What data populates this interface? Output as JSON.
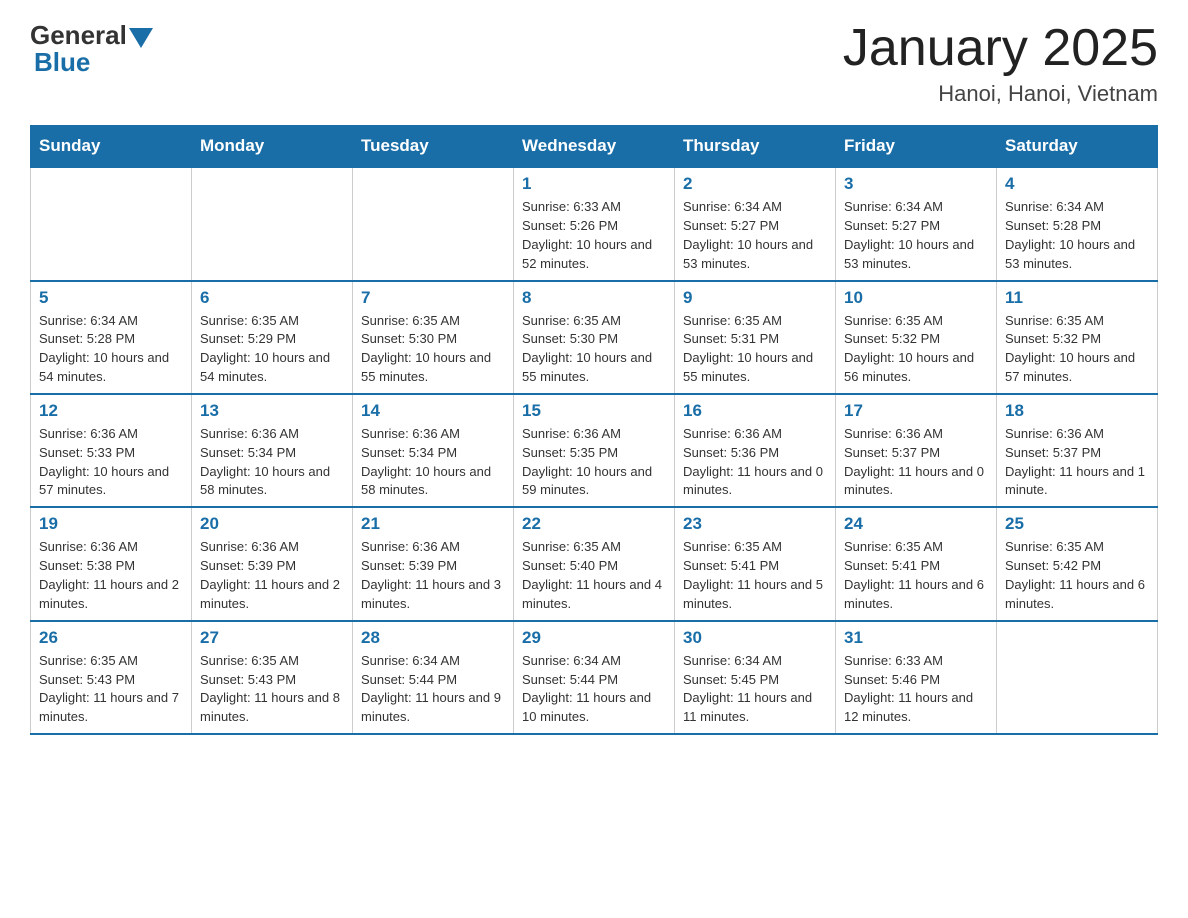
{
  "header": {
    "logo_general": "General",
    "logo_blue": "Blue",
    "month_title": "January 2025",
    "location": "Hanoi, Hanoi, Vietnam"
  },
  "weekdays": [
    "Sunday",
    "Monday",
    "Tuesday",
    "Wednesday",
    "Thursday",
    "Friday",
    "Saturday"
  ],
  "weeks": [
    [
      {
        "day": "",
        "info": ""
      },
      {
        "day": "",
        "info": ""
      },
      {
        "day": "",
        "info": ""
      },
      {
        "day": "1",
        "info": "Sunrise: 6:33 AM\nSunset: 5:26 PM\nDaylight: 10 hours and 52 minutes."
      },
      {
        "day": "2",
        "info": "Sunrise: 6:34 AM\nSunset: 5:27 PM\nDaylight: 10 hours and 53 minutes."
      },
      {
        "day": "3",
        "info": "Sunrise: 6:34 AM\nSunset: 5:27 PM\nDaylight: 10 hours and 53 minutes."
      },
      {
        "day": "4",
        "info": "Sunrise: 6:34 AM\nSunset: 5:28 PM\nDaylight: 10 hours and 53 minutes."
      }
    ],
    [
      {
        "day": "5",
        "info": "Sunrise: 6:34 AM\nSunset: 5:28 PM\nDaylight: 10 hours and 54 minutes."
      },
      {
        "day": "6",
        "info": "Sunrise: 6:35 AM\nSunset: 5:29 PM\nDaylight: 10 hours and 54 minutes."
      },
      {
        "day": "7",
        "info": "Sunrise: 6:35 AM\nSunset: 5:30 PM\nDaylight: 10 hours and 55 minutes."
      },
      {
        "day": "8",
        "info": "Sunrise: 6:35 AM\nSunset: 5:30 PM\nDaylight: 10 hours and 55 minutes."
      },
      {
        "day": "9",
        "info": "Sunrise: 6:35 AM\nSunset: 5:31 PM\nDaylight: 10 hours and 55 minutes."
      },
      {
        "day": "10",
        "info": "Sunrise: 6:35 AM\nSunset: 5:32 PM\nDaylight: 10 hours and 56 minutes."
      },
      {
        "day": "11",
        "info": "Sunrise: 6:35 AM\nSunset: 5:32 PM\nDaylight: 10 hours and 57 minutes."
      }
    ],
    [
      {
        "day": "12",
        "info": "Sunrise: 6:36 AM\nSunset: 5:33 PM\nDaylight: 10 hours and 57 minutes."
      },
      {
        "day": "13",
        "info": "Sunrise: 6:36 AM\nSunset: 5:34 PM\nDaylight: 10 hours and 58 minutes."
      },
      {
        "day": "14",
        "info": "Sunrise: 6:36 AM\nSunset: 5:34 PM\nDaylight: 10 hours and 58 minutes."
      },
      {
        "day": "15",
        "info": "Sunrise: 6:36 AM\nSunset: 5:35 PM\nDaylight: 10 hours and 59 minutes."
      },
      {
        "day": "16",
        "info": "Sunrise: 6:36 AM\nSunset: 5:36 PM\nDaylight: 11 hours and 0 minutes."
      },
      {
        "day": "17",
        "info": "Sunrise: 6:36 AM\nSunset: 5:37 PM\nDaylight: 11 hours and 0 minutes."
      },
      {
        "day": "18",
        "info": "Sunrise: 6:36 AM\nSunset: 5:37 PM\nDaylight: 11 hours and 1 minute."
      }
    ],
    [
      {
        "day": "19",
        "info": "Sunrise: 6:36 AM\nSunset: 5:38 PM\nDaylight: 11 hours and 2 minutes."
      },
      {
        "day": "20",
        "info": "Sunrise: 6:36 AM\nSunset: 5:39 PM\nDaylight: 11 hours and 2 minutes."
      },
      {
        "day": "21",
        "info": "Sunrise: 6:36 AM\nSunset: 5:39 PM\nDaylight: 11 hours and 3 minutes."
      },
      {
        "day": "22",
        "info": "Sunrise: 6:35 AM\nSunset: 5:40 PM\nDaylight: 11 hours and 4 minutes."
      },
      {
        "day": "23",
        "info": "Sunrise: 6:35 AM\nSunset: 5:41 PM\nDaylight: 11 hours and 5 minutes."
      },
      {
        "day": "24",
        "info": "Sunrise: 6:35 AM\nSunset: 5:41 PM\nDaylight: 11 hours and 6 minutes."
      },
      {
        "day": "25",
        "info": "Sunrise: 6:35 AM\nSunset: 5:42 PM\nDaylight: 11 hours and 6 minutes."
      }
    ],
    [
      {
        "day": "26",
        "info": "Sunrise: 6:35 AM\nSunset: 5:43 PM\nDaylight: 11 hours and 7 minutes."
      },
      {
        "day": "27",
        "info": "Sunrise: 6:35 AM\nSunset: 5:43 PM\nDaylight: 11 hours and 8 minutes."
      },
      {
        "day": "28",
        "info": "Sunrise: 6:34 AM\nSunset: 5:44 PM\nDaylight: 11 hours and 9 minutes."
      },
      {
        "day": "29",
        "info": "Sunrise: 6:34 AM\nSunset: 5:44 PM\nDaylight: 11 hours and 10 minutes."
      },
      {
        "day": "30",
        "info": "Sunrise: 6:34 AM\nSunset: 5:45 PM\nDaylight: 11 hours and 11 minutes."
      },
      {
        "day": "31",
        "info": "Sunrise: 6:33 AM\nSunset: 5:46 PM\nDaylight: 11 hours and 12 minutes."
      },
      {
        "day": "",
        "info": ""
      }
    ]
  ]
}
